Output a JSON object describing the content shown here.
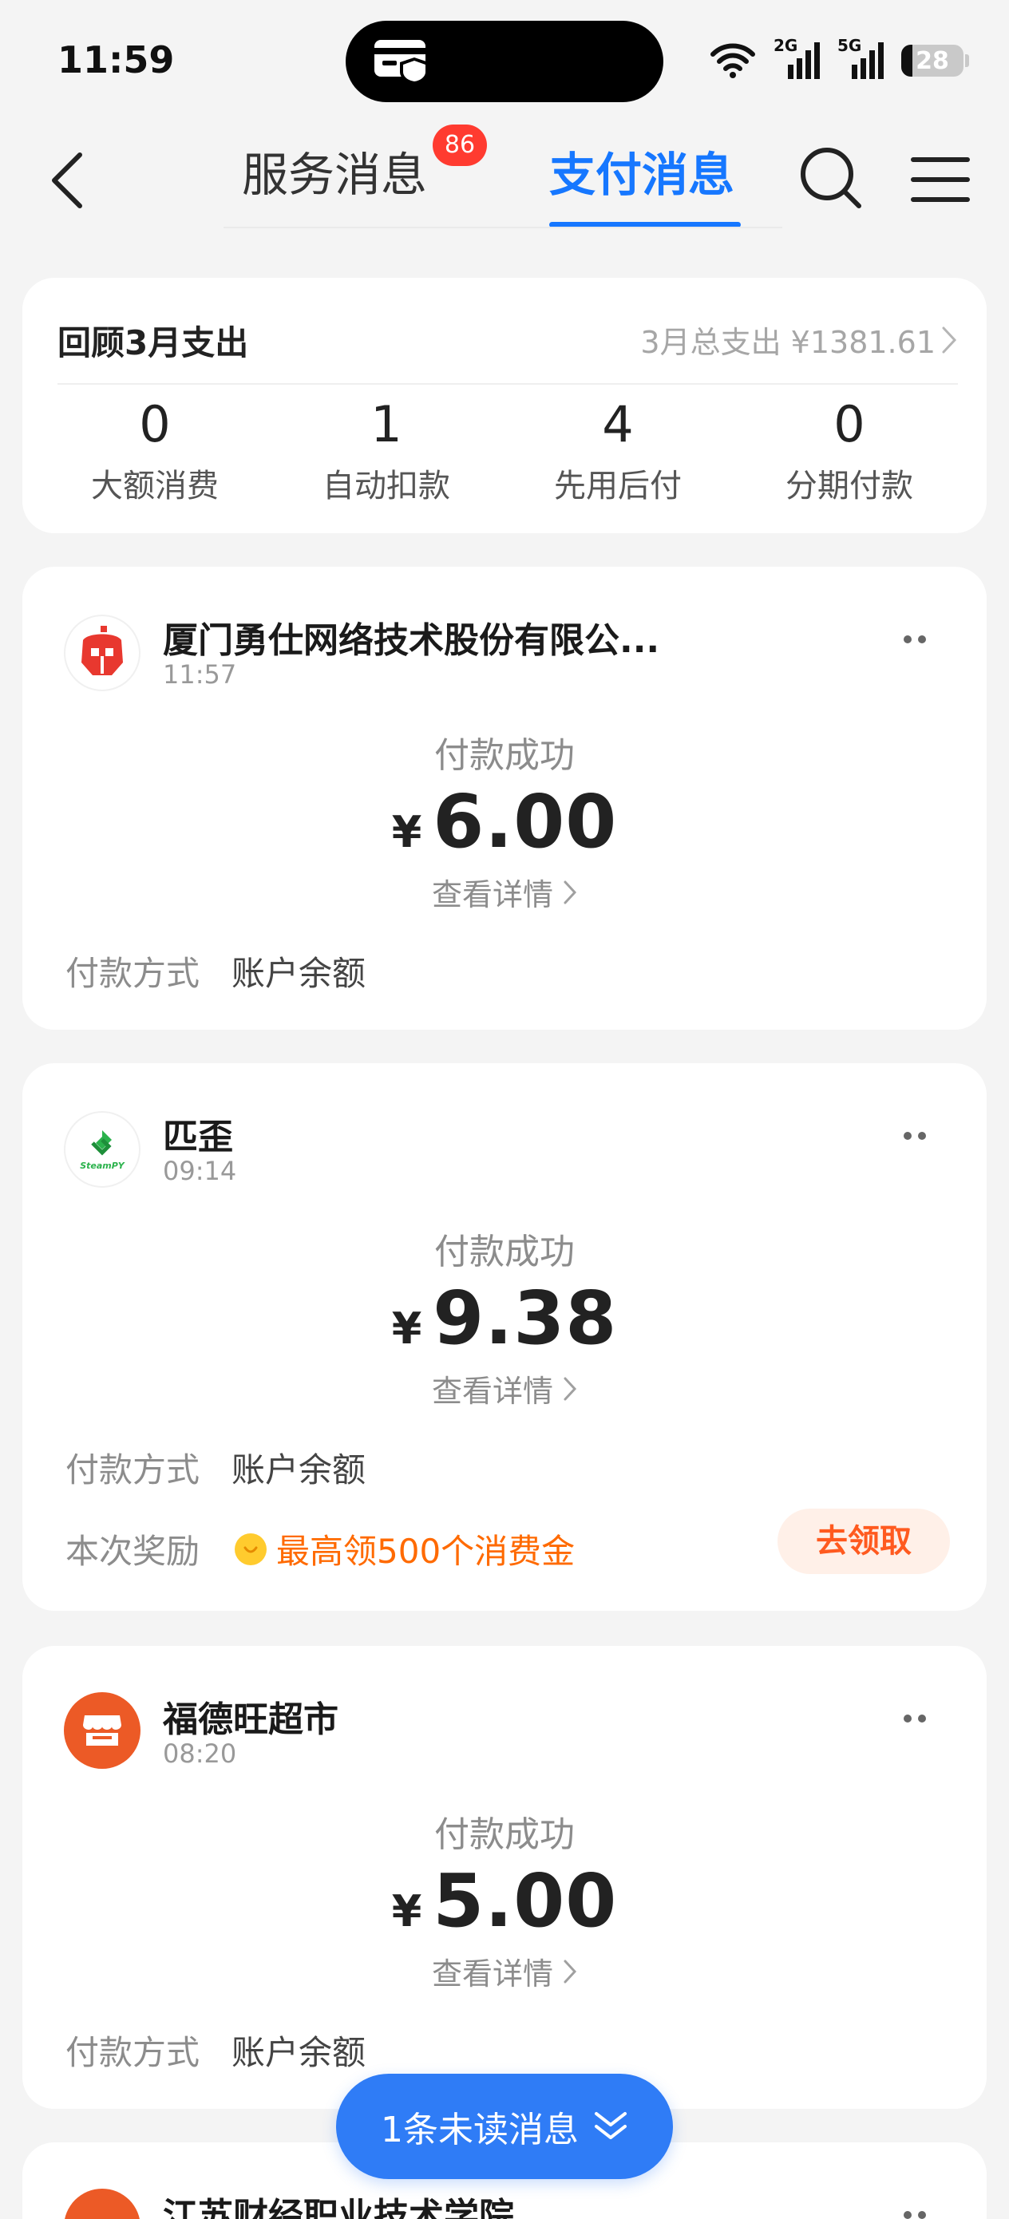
{
  "status_bar": {
    "time": "11:59",
    "network_2g": "2G",
    "network_5g": "5G",
    "battery": "28"
  },
  "header": {
    "tab_service": "服务消息",
    "service_badge": "86",
    "tab_pay": "支付消息",
    "accent_color": "#1677ff"
  },
  "review": {
    "title": "回顾3月支出",
    "total": "3月总支出 ¥1381.61",
    "stats": [
      {
        "value": "0",
        "label": "大额消费"
      },
      {
        "value": "1",
        "label": "自动扣款"
      },
      {
        "value": "4",
        "label": "先用后付"
      },
      {
        "value": "0",
        "label": "分期付款"
      }
    ]
  },
  "messages": [
    {
      "merchant": "厦门勇仕网络技术股份有限公...",
      "time": "11:57",
      "status": "付款成功",
      "currency": "¥",
      "amount": "6.00",
      "detail": "查看详情",
      "method_label": "付款方式",
      "method_value": "账户余额"
    },
    {
      "merchant": "匹歪",
      "logo_text": "SteamPY",
      "time": "09:14",
      "status": "付款成功",
      "currency": "¥",
      "amount": "9.38",
      "detail": "查看详情",
      "method_label": "付款方式",
      "method_value": "账户余额",
      "reward_label": "本次奖励",
      "reward_text": "最高领500个消费金",
      "claim_label": "去领取"
    },
    {
      "merchant": "福德旺超市",
      "time": "08:20",
      "status": "付款成功",
      "currency": "¥",
      "amount": "5.00",
      "detail": "查看详情",
      "method_label": "付款方式",
      "method_value": "账户余额"
    },
    {
      "merchant": "江苏财经职业技术学院"
    }
  ],
  "unread": {
    "label": "1条未读消息"
  }
}
